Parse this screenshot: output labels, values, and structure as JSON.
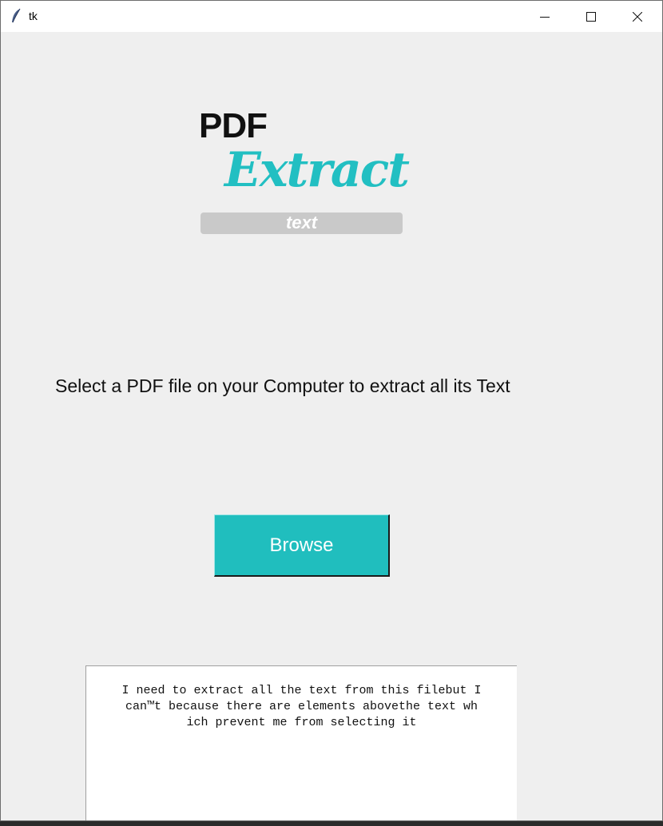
{
  "window": {
    "title": "tk",
    "controls": {
      "minimize_icon": "minimize-icon",
      "maximize_icon": "maximize-icon",
      "close_icon": "close-icon"
    }
  },
  "logo": {
    "line1": "PDF",
    "line2": "Extract",
    "line3": "text",
    "accent_color": "#22bfc2"
  },
  "instruction": "Select a PDF file on your Computer to extract all its Text",
  "browse_button": {
    "label": "Browse",
    "color": "#20bebe"
  },
  "output_text": "I need to extract all the text from this filebut I\ncan™t because there are elements abovethe text wh\nich prevent me from selecting it"
}
